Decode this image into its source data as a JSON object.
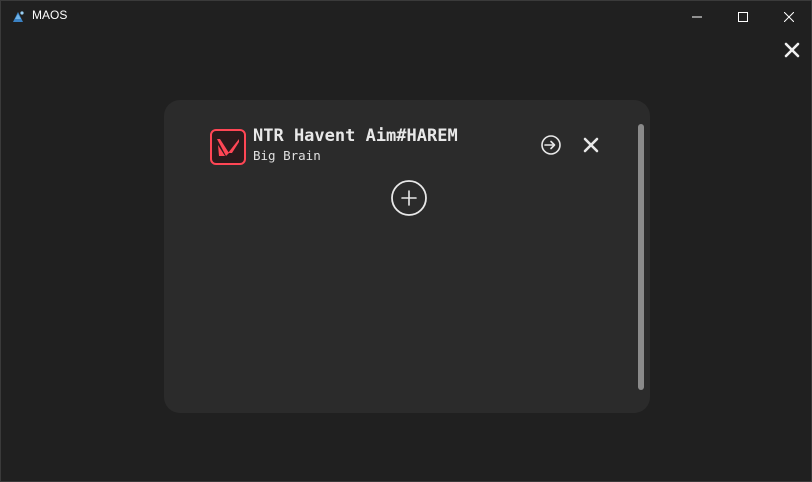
{
  "window": {
    "title": "MAOS",
    "icon": "maos-app-icon",
    "controls": {
      "minimize_icon": "minimize-icon",
      "maximize_icon": "maximize-icon",
      "close_icon": "close-icon"
    }
  },
  "app": {
    "close_icon": "close-icon"
  },
  "accounts": [
    {
      "name": "NTR Havent Aim#HAREM",
      "rank": "Big Brain",
      "game_icon": "valorant-logo-icon",
      "actions": {
        "login_icon": "login-icon",
        "remove_icon": "close-icon"
      }
    }
  ],
  "add_account": {
    "icon": "plus-circle-icon"
  },
  "colors": {
    "background": "#202020",
    "panel": "#2b2b2b",
    "text": "#e8e8e8",
    "accent": "#ff4655",
    "scrollbar": "#8a8a8a",
    "app_icon": "#3b82c4"
  }
}
